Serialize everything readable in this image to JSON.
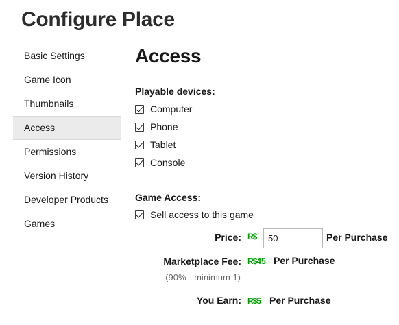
{
  "page_title": "Configure Place",
  "sidebar": {
    "items": [
      {
        "label": "Basic Settings"
      },
      {
        "label": "Game Icon"
      },
      {
        "label": "Thumbnails"
      },
      {
        "label": "Access"
      },
      {
        "label": "Permissions"
      },
      {
        "label": "Version History"
      },
      {
        "label": "Developer Products"
      },
      {
        "label": "Games"
      }
    ]
  },
  "main": {
    "section_title": "Access",
    "playable_devices": {
      "label": "Playable devices:",
      "options": [
        {
          "label": "Computer",
          "checked": true
        },
        {
          "label": "Phone",
          "checked": true
        },
        {
          "label": "Tablet",
          "checked": true
        },
        {
          "label": "Console",
          "checked": true
        }
      ]
    },
    "game_access": {
      "label": "Game Access:",
      "sell_access_label": "Sell access to this game",
      "sell_access_checked": true
    },
    "price": {
      "label": "Price:",
      "currency_symbol": "R$",
      "value": "50",
      "suffix": "Per Purchase"
    },
    "marketplace_fee": {
      "label": "Marketplace Fee:",
      "currency_symbol": "R$",
      "amount": "45",
      "suffix": "Per Purchase",
      "note": "(90% - minimum 1)"
    },
    "you_earn": {
      "label": "You Earn:",
      "currency_symbol": "R$",
      "amount": "5",
      "suffix": "Per Purchase"
    }
  },
  "colors": {
    "robux_green": "#00a000",
    "active_bg": "#ebebeb",
    "divider": "#b8b8b8"
  }
}
